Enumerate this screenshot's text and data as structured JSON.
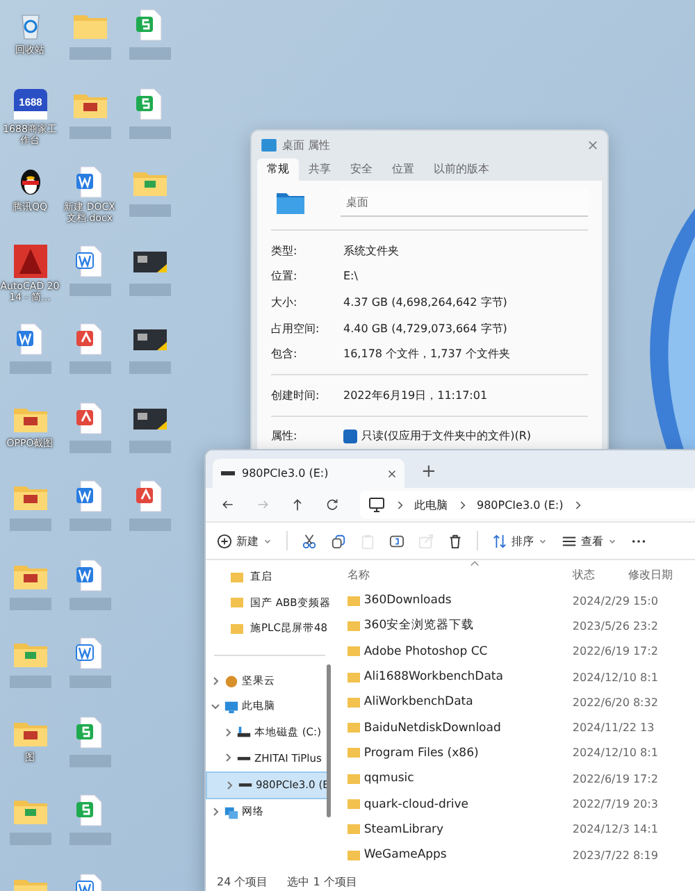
{
  "desktop": {
    "columns": [
      [
        {
          "kind": "recycle",
          "label": "回收站"
        },
        {
          "kind": "app1688",
          "label": "1688商家工作台",
          "badge": "1688"
        },
        {
          "kind": "qq",
          "label": "腾讯QQ"
        },
        {
          "kind": "cad",
          "label": "AutoCAD 2014 - 简..."
        },
        {
          "kind": "word"
        },
        {
          "kind": "photofolder",
          "label": "OPPO截图"
        },
        {
          "kind": "photofolder"
        },
        {
          "kind": "photofolder"
        },
        {
          "kind": "greenfolder"
        },
        {
          "kind": "photofolder",
          "label": "图"
        },
        {
          "kind": "greenfolder"
        },
        {
          "kind": "folder"
        }
      ],
      [
        {
          "kind": "folder"
        },
        {
          "kind": "photofolder"
        },
        {
          "kind": "word",
          "label": "新建 DOCX 文档.docx"
        },
        {
          "kind": "wordoutline"
        },
        {
          "kind": "pdf"
        },
        {
          "kind": "pdf"
        },
        {
          "kind": "word"
        },
        {
          "kind": "word"
        },
        {
          "kind": "wordoutline"
        },
        {
          "kind": "sheet"
        },
        {
          "kind": "sheet"
        },
        {
          "kind": "wordoutline"
        }
      ],
      [
        {
          "kind": "sheet"
        },
        {
          "kind": "sheet"
        },
        {
          "kind": "greenfolder"
        },
        {
          "kind": "video"
        },
        {
          "kind": "video"
        },
        {
          "kind": "video"
        },
        {
          "kind": "pdf"
        }
      ]
    ]
  },
  "properties": {
    "title": "桌面 属性",
    "tabs": [
      {
        "label": "常规",
        "selected": true
      },
      {
        "label": "共享",
        "selected": false
      },
      {
        "label": "安全",
        "selected": false
      },
      {
        "label": "位置",
        "selected": false
      },
      {
        "label": "以前的版本",
        "selected": false
      }
    ],
    "name": "桌面",
    "groups": [
      [
        {
          "label": "类型:",
          "value": "系统文件夹"
        },
        {
          "label": "位置:",
          "value": "E:\\"
        },
        {
          "label": "大小:",
          "value": "4.37 GB (4,698,264,642 字节)"
        },
        {
          "label": "占用空间:",
          "value": "4.40 GB (4,729,073,664 字节)"
        },
        {
          "label": "包含:",
          "value": "16,178 个文件，1,737 个文件夹"
        }
      ],
      [
        {
          "label": "创建时间:",
          "value": "2022年6月19日，11:17:01"
        }
      ]
    ],
    "attributes": {
      "label": "属性:",
      "readonly": {
        "label": "只读(仅应用于文件夹中的文件)(R)",
        "checked": true
      }
    }
  },
  "explorer": {
    "tab": "980PCIe3.0 (E:)",
    "new_tab": "+",
    "nav": [
      {
        "kind": "back",
        "disabled": false
      },
      {
        "kind": "forward",
        "disabled": true
      },
      {
        "kind": "up",
        "disabled": false
      },
      {
        "kind": "refresh",
        "disabled": false
      }
    ],
    "breadcrumb": [
      "此电脑",
      "980PCIe3.0 (E:)"
    ],
    "toolbar": [
      {
        "kind": "new",
        "label": "新建",
        "disabled": false
      },
      {
        "kind": "cut",
        "disabled": false
      },
      {
        "kind": "copy",
        "disabled": false
      },
      {
        "kind": "paste",
        "disabled": true
      },
      {
        "kind": "rename",
        "disabled": false
      },
      {
        "kind": "share",
        "disabled": true
      },
      {
        "kind": "delete",
        "disabled": false
      },
      {
        "kind": "sort",
        "label": "排序",
        "disabled": false
      },
      {
        "kind": "view",
        "label": "查看",
        "disabled": false
      },
      {
        "kind": "more",
        "disabled": false
      }
    ],
    "quick_access": [
      "直启",
      "国产 ABB变频器",
      "施PLC昆屏带48"
    ],
    "tree": [
      {
        "label": "坚果云",
        "kind": "nut",
        "expanded": false,
        "selected": false
      },
      {
        "label": "此电脑",
        "kind": "pc",
        "expanded": true,
        "selected": false,
        "children": [
          {
            "label": "本地磁盘 (C:)",
            "kind": "sysdisk",
            "expanded": false,
            "selected": false
          },
          {
            "label": "ZHITAI TiPlus",
            "kind": "disk",
            "expanded": false,
            "selected": false
          },
          {
            "label": "980PCIe3.0 (E",
            "kind": "disk",
            "expanded": false,
            "selected": true
          }
        ]
      },
      {
        "label": "网络",
        "kind": "network",
        "expanded": false,
        "selected": false
      }
    ],
    "columns": [
      "名称",
      "状态",
      "修改日期"
    ],
    "rows": [
      {
        "name": "360Downloads",
        "date": "2024/2/29 15:0"
      },
      {
        "name": "360安全浏览器下载",
        "date": "2023/5/26 23:2"
      },
      {
        "name": "Adobe Photoshop CC",
        "date": "2022/6/19 17:2"
      },
      {
        "name": "Ali1688WorkbenchData",
        "date": "2024/12/10 8:1"
      },
      {
        "name": "AliWorkbenchData",
        "date": "2022/6/20 8:32"
      },
      {
        "name": "BaiduNetdiskDownload",
        "date": "2024/11/22 13"
      },
      {
        "name": "Program Files (x86)",
        "date": "2024/12/10 8:1"
      },
      {
        "name": "qqmusic",
        "date": "2022/6/19 17:2"
      },
      {
        "name": "quark-cloud-drive",
        "date": "2022/7/19 20:3"
      },
      {
        "name": "SteamLibrary",
        "date": "2024/12/3 14:1"
      },
      {
        "name": "WeGameApps",
        "date": "2023/7/22 8:19"
      }
    ],
    "status": [
      "24 个项目",
      "选中 1 个项目"
    ]
  }
}
